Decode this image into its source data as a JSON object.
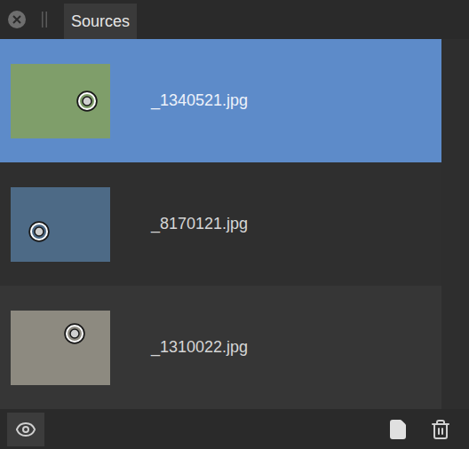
{
  "panel": {
    "tab": "Sources"
  },
  "sources": [
    {
      "name": "_1340521.jpg",
      "selected": true,
      "color": "#7f9e6a"
    },
    {
      "name": "_8170121.jpg",
      "selected": false,
      "color": "#4d6a86"
    },
    {
      "name": "_1310022.jpg",
      "selected": false,
      "color": "#8d8a80"
    }
  ]
}
